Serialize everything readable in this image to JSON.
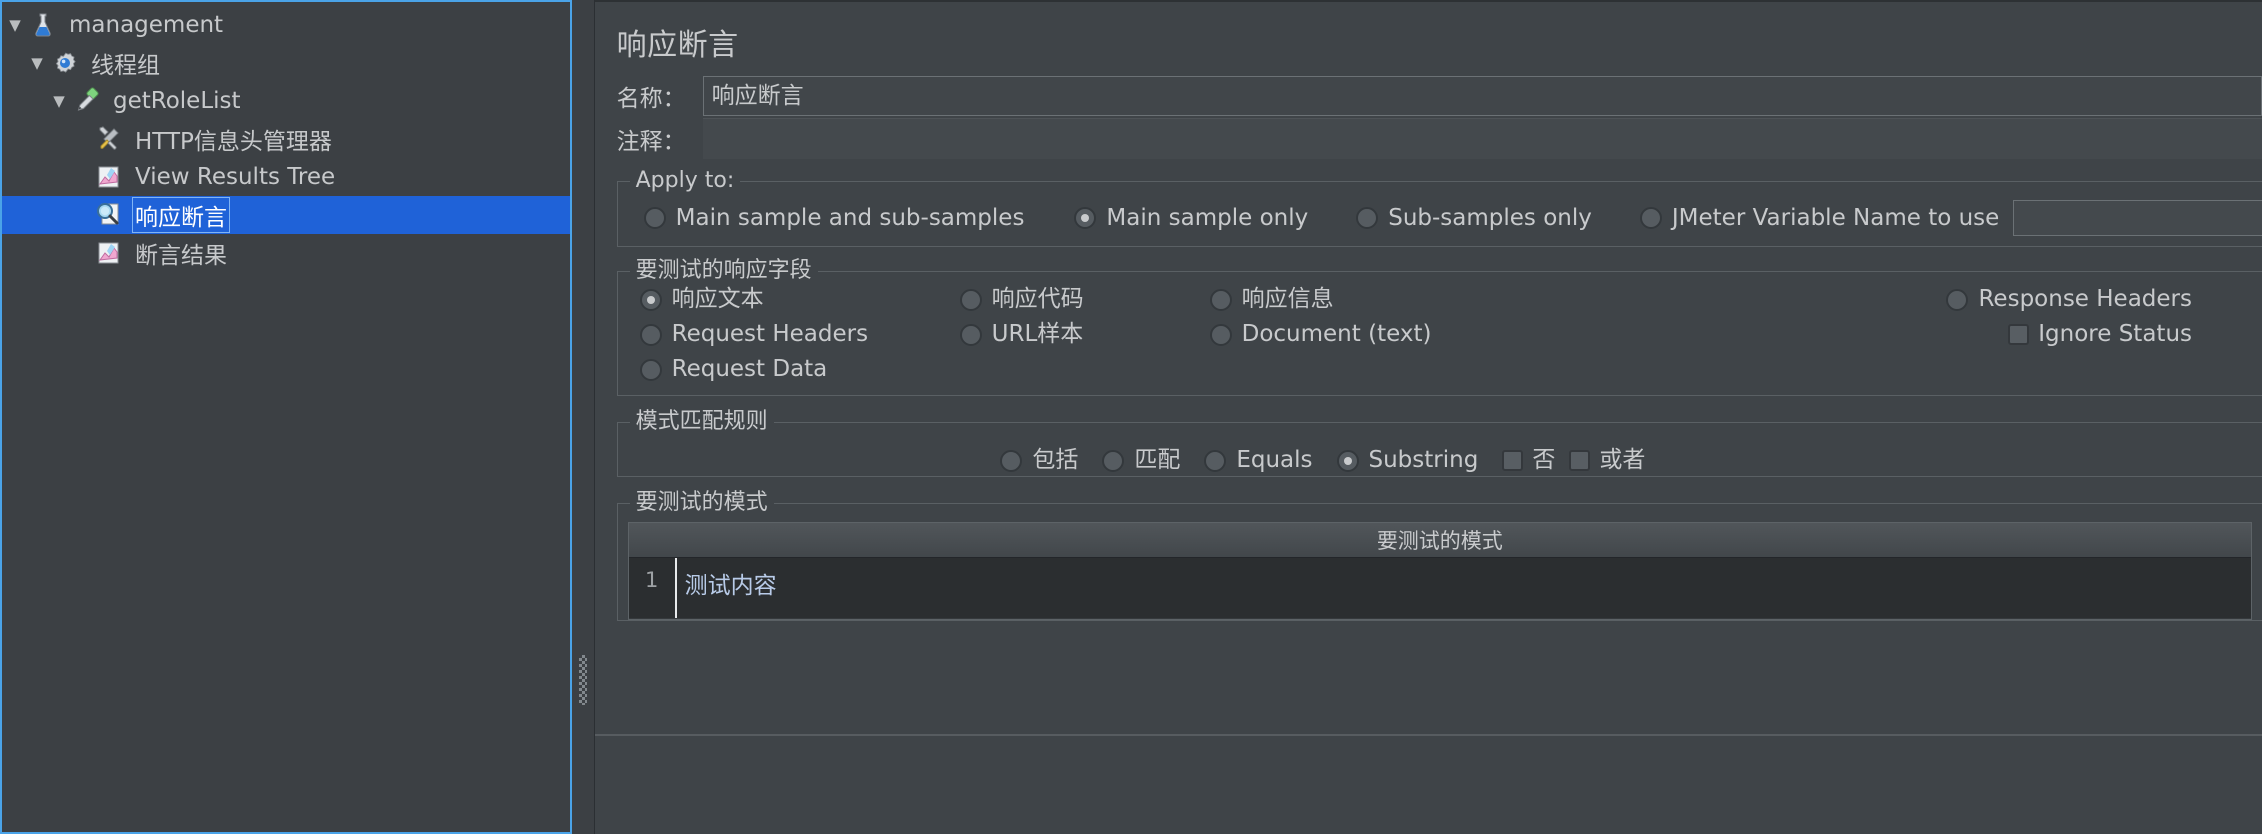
{
  "tree": {
    "items": [
      {
        "label": "management",
        "icon": "flask-icon",
        "toggle": "▼",
        "indent": 0,
        "selected": false
      },
      {
        "label": "线程组",
        "icon": "gear-icon",
        "toggle": "▼",
        "indent": 1,
        "selected": false
      },
      {
        "label": "getRoleList",
        "icon": "pipette-icon",
        "toggle": "▼",
        "indent": 2,
        "selected": false
      },
      {
        "label": "HTTP信息头管理器",
        "icon": "tools-icon",
        "toggle": "",
        "indent": 3,
        "selected": false
      },
      {
        "label": "View Results Tree",
        "icon": "chart-icon",
        "toggle": "",
        "indent": 3,
        "selected": false
      },
      {
        "label": "响应断言",
        "icon": "magnify-icon",
        "toggle": "",
        "indent": 3,
        "selected": true
      },
      {
        "label": "断言结果",
        "icon": "chart-icon",
        "toggle": "",
        "indent": 3,
        "selected": false
      }
    ]
  },
  "panel": {
    "title": "响应断言",
    "name_label": "名称：",
    "name_value": "响应断言",
    "comment_label": "注释：",
    "comment_value": ""
  },
  "apply_to": {
    "title": "Apply to:",
    "options": [
      {
        "label": "Main sample and sub-samples",
        "selected": false
      },
      {
        "label": "Main sample only",
        "selected": true
      },
      {
        "label": "Sub-samples only",
        "selected": false
      },
      {
        "label": "JMeter Variable Name to use",
        "selected": false
      }
    ],
    "variable_value": ""
  },
  "response_field": {
    "title": "要测试的响应字段",
    "column1": [
      {
        "label": "响应文本",
        "selected": true,
        "type": "radio"
      },
      {
        "label": "Request Headers",
        "selected": false,
        "type": "radio"
      },
      {
        "label": "Request Data",
        "selected": false,
        "type": "radio"
      }
    ],
    "column2": [
      {
        "label": "响应代码",
        "selected": false,
        "type": "radio"
      },
      {
        "label": "URL样本",
        "selected": false,
        "type": "radio"
      }
    ],
    "column3": [
      {
        "label": "响应信息",
        "selected": false,
        "type": "radio"
      },
      {
        "label": "Document (text)",
        "selected": false,
        "type": "radio"
      }
    ],
    "column4": [
      {
        "label": "Response Headers",
        "selected": false,
        "type": "radio"
      },
      {
        "label": "Ignore Status",
        "selected": false,
        "type": "checkbox"
      }
    ]
  },
  "pattern_rules": {
    "title": "模式匹配规则",
    "options": [
      {
        "label": "包括",
        "selected": false,
        "type": "radio"
      },
      {
        "label": "匹配",
        "selected": false,
        "type": "radio"
      },
      {
        "label": "Equals",
        "selected": false,
        "type": "radio"
      },
      {
        "label": "Substring",
        "selected": true,
        "type": "radio"
      },
      {
        "label": "否",
        "selected": false,
        "type": "checkbox"
      },
      {
        "label": "或者",
        "selected": false,
        "type": "checkbox"
      }
    ]
  },
  "patterns": {
    "title": "要测试的模式",
    "column_header": "要测试的模式",
    "rows": [
      {
        "num": "1",
        "value": "测试内容"
      }
    ]
  },
  "colors": {
    "selection_blue": "#1f62d8",
    "focus_border": "#4aa3e8",
    "panel_bg": "#3f4448",
    "text": "#c8cacc"
  }
}
